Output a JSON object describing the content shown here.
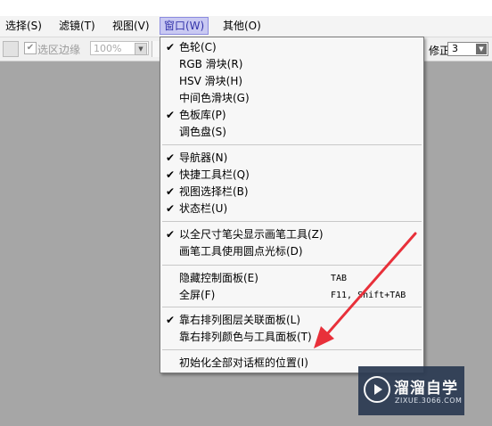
{
  "menubar": {
    "items": [
      {
        "label": "选择(S)"
      },
      {
        "label": "滤镜(T)"
      },
      {
        "label": "视图(V)"
      },
      {
        "label": "窗口(W)"
      },
      {
        "label": "其他(O)"
      }
    ]
  },
  "toolbar": {
    "checkbox_label": "选区边缘",
    "zoom_value": "100%",
    "correction_label": "修正",
    "correction_value": "3"
  },
  "dropdown": {
    "items": [
      {
        "label": "色轮(C)",
        "checked": true
      },
      {
        "label": "RGB 滑块(R)",
        "checked": false
      },
      {
        "label": "HSV 滑块(H)",
        "checked": false
      },
      {
        "label": "中间色滑块(G)",
        "checked": false
      },
      {
        "label": "色板库(P)",
        "checked": true
      },
      {
        "label": "调色盘(S)",
        "checked": false
      },
      {
        "label": "导航器(N)",
        "checked": true
      },
      {
        "label": "快捷工具栏(Q)",
        "checked": true
      },
      {
        "label": "视图选择栏(B)",
        "checked": true
      },
      {
        "label": "状态栏(U)",
        "checked": true
      },
      {
        "label": "以全尺寸笔尖显示画笔工具(Z)",
        "checked": true
      },
      {
        "label": "画笔工具使用圆点光标(D)",
        "checked": false
      },
      {
        "label": "隐藏控制面板(E)",
        "checked": false,
        "shortcut": "TAB"
      },
      {
        "label": "全屏(F)",
        "checked": false,
        "shortcut": "F11, Shift+TAB"
      },
      {
        "label": "靠右排列图层关联面板(L)",
        "checked": true
      },
      {
        "label": "靠右排列颜色与工具面板(T)",
        "checked": false
      },
      {
        "label": "初始化全部对话框的位置(I)",
        "checked": false
      }
    ],
    "check_glyph": "✔"
  },
  "watermark": {
    "title": "溜溜自学",
    "url": "ZIXUE.3066.COM"
  },
  "colors": {
    "arrow": "#e8303a",
    "canvas": "#a6a6a6",
    "menu_active": "#c9c9f2"
  }
}
